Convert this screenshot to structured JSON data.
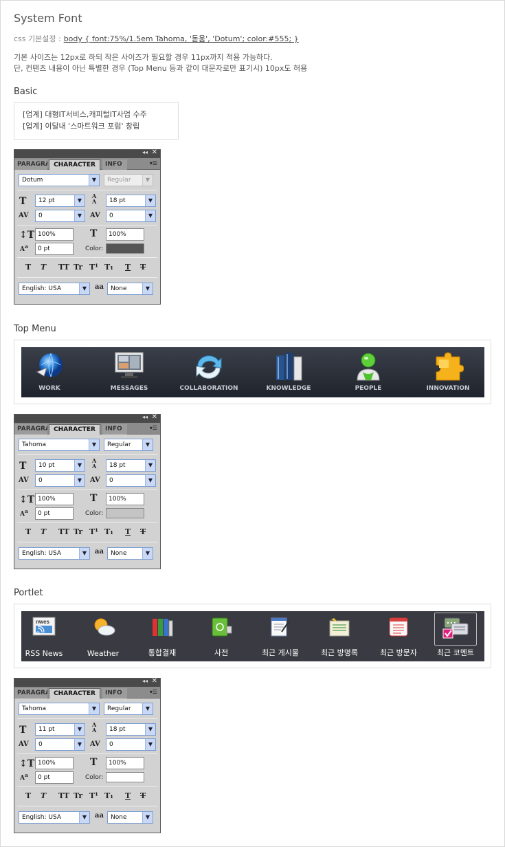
{
  "title": "System Font",
  "css_line": {
    "label": "css 기본설정 :",
    "code": "body { font:75%/1.5em Tahoma, '돋움', 'Dotum'; color:#555; }"
  },
  "desc": [
    "기본 사이즈는 12px로 하되 작은 사이즈가 필요할 경우 11px까지 적용 가능하다.",
    "단, 컨텐츠 내용이 아닌 특별한 경우 (Top Menu 등과 같이 대문자로만 표기시) 10px도 허용"
  ],
  "sections": {
    "basic": "Basic",
    "top_menu": "Top Menu",
    "portlet": "Portlet"
  },
  "basic_box": [
    "[업계] 대형IT서비스,캐피털IT사업 수주",
    "[업계] 이달내 '스마트워크 포럼' 창립"
  ],
  "panel_common": {
    "tab_paragraph": "PARAGRAPH",
    "tab_character": "CHARACTER",
    "tab_info": "INFO",
    "color_label": "Color:",
    "styles": [
      "T",
      "T",
      "TT",
      "Tr",
      "T¹",
      "T₁",
      "T",
      "T"
    ],
    "lang": "English: USA",
    "aa_label": "aa",
    "aa_value": "None"
  },
  "panels": [
    {
      "font": "Dotum",
      "style": "Regular",
      "style_disabled": true,
      "size": "12 pt",
      "leading": "18 pt",
      "kerning": "0",
      "tracking": "0",
      "vscale": "100%",
      "hscale": "100%",
      "baseline": "0 pt",
      "color": "#555555"
    },
    {
      "font": "Tahoma",
      "style": "Regular",
      "style_disabled": false,
      "size": "10 pt",
      "leading": "18 pt",
      "kerning": "0",
      "tracking": "0",
      "vscale": "100%",
      "hscale": "100%",
      "baseline": "0 pt",
      "color": "#c4c4c4"
    },
    {
      "font": "Tahoma",
      "style": "Regular",
      "style_disabled": false,
      "size": "11 pt",
      "leading": "18 pt",
      "kerning": "0",
      "tracking": "0",
      "vscale": "100%",
      "hscale": "100%",
      "baseline": "0 pt",
      "color": "#ffffff"
    }
  ],
  "top_menu": [
    {
      "label": "WORK",
      "icon": "globe-icon"
    },
    {
      "label": "MESSAGES",
      "icon": "monitor-icon"
    },
    {
      "label": "COLLABORATION",
      "icon": "sync-arrows-icon"
    },
    {
      "label": "KNOWLEDGE",
      "icon": "books-icon"
    },
    {
      "label": "PEOPLE",
      "icon": "person-icon"
    },
    {
      "label": "INNOVATION",
      "icon": "puzzle-icon"
    }
  ],
  "portlet": [
    {
      "label": "RSS News",
      "icon": "rss-news-icon",
      "icon_text": "nwes"
    },
    {
      "label": "Weather",
      "icon": "weather-icon"
    },
    {
      "label": "통합결재",
      "icon": "binders-icon"
    },
    {
      "label": "사전",
      "icon": "dictionary-icon"
    },
    {
      "label": "최근 게시물",
      "icon": "notepad-icon"
    },
    {
      "label": "최근 방명록",
      "icon": "guestbook-icon"
    },
    {
      "label": "최근 방문자",
      "icon": "visitor-list-icon"
    },
    {
      "label": "최근 코멘트",
      "icon": "comment-icon",
      "active": true
    }
  ]
}
